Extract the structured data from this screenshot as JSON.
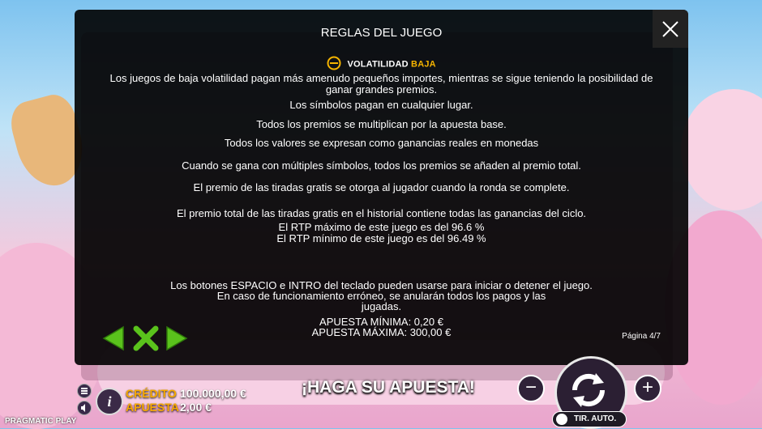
{
  "modal": {
    "title": "REGLAS DEL JUEGO",
    "volatility_label": "VOLATILIDAD",
    "volatility_level": "BAJA",
    "rules": [
      "Los juegos de baja volatilidad pagan más amenudo pequeños importes, mientras se sigue teniendo la posibilidad de",
      "ganar grandes premios.",
      "Los símbolos pagan en cualquier lugar.",
      "Todos los premios se multiplican por la apuesta base.",
      "Todos los valores se expresan como ganancias reales en monedas",
      "Cuando se gana con múltiples símbolos, todos los premios se añaden al premio total.",
      "El premio de las tiradas gratis se otorga al jugador cuando la ronda se complete.",
      "El premio total de las tiradas gratis en el historial contiene todas las ganancias del ciclo.",
      "El RTP máximo de este juego es del 96.6 %",
      "El RTP mínimo de este juego es del 96.49 %",
      "Los botones ESPACIO e INTRO del teclado pueden usarse para iniciar o detener el juego.",
      "En caso de funcionamiento erróneo, se anularán todos los pagos y las",
      "jugadas.",
      "APUESTA MÍNIMA: 0,20 €",
      "APUESTA MÁXIMA: 300,00 €"
    ],
    "page_indicator": "Página 4/7"
  },
  "bottom_bar": {
    "credit_label": "CRÉDITO",
    "credit_value": "100.000,00 €",
    "bet_label": "APUESTA",
    "bet_value": "2,00 €",
    "message": "¡HAGA SU APUESTA!",
    "autoplay_label": "TIR. AUTO.",
    "minus_symbol": "−",
    "plus_symbol": "+",
    "info_symbol": "i",
    "brand": "PRAGMATIC PLAY"
  },
  "colors": {
    "accent": "#f5b400",
    "nav_green": "#5ac21c",
    "modal_bg": "#000000"
  }
}
